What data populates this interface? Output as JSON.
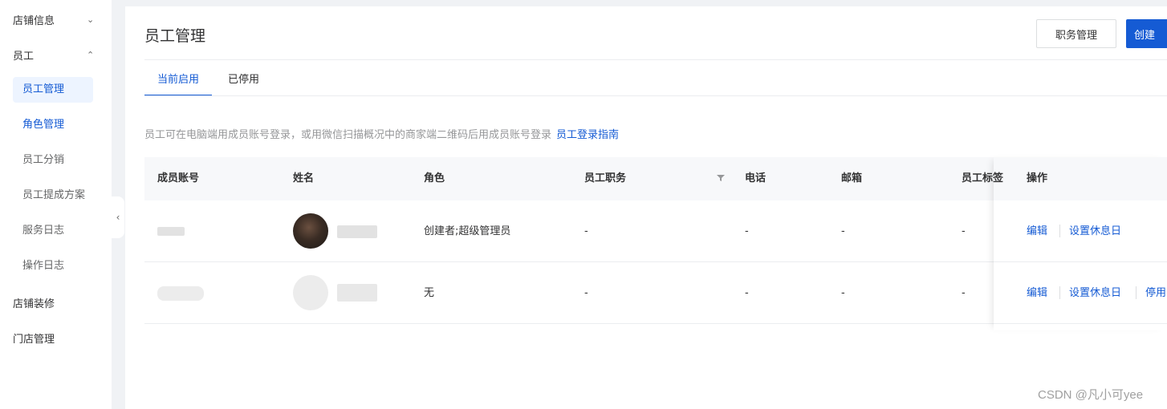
{
  "sidebar": {
    "groups": [
      {
        "label": "店铺信息",
        "arrow": "⌄"
      },
      {
        "label": "员工",
        "arrow": "⌃"
      },
      {
        "label": "店铺装修"
      },
      {
        "label": "门店管理"
      }
    ],
    "items": [
      {
        "label": "员工管理"
      },
      {
        "label": "角色管理"
      },
      {
        "label": "员工分销"
      },
      {
        "label": "员工提成方案"
      },
      {
        "label": "服务日志"
      },
      {
        "label": "操作日志"
      }
    ],
    "collapse_icon": "‹"
  },
  "header": {
    "title": "员工管理",
    "btn_roles": "职务管理",
    "btn_create": "创建"
  },
  "tabs": [
    {
      "label": "当前启用"
    },
    {
      "label": "已停用"
    }
  ],
  "tip": {
    "text": "员工可在电脑端用成员账号登录，或用微信扫描概况中的商家端二维码后用成员账号登录",
    "link": "员工登录指南"
  },
  "table": {
    "columns": [
      "成员账号",
      "姓名",
      "角色",
      "员工职务",
      "电话",
      "邮箱",
      "员工标签",
      "操作"
    ],
    "rows": [
      {
        "role": "创建者;超级管理员",
        "duty": "-",
        "phone": "-",
        "email": "-",
        "tag": "-",
        "actions": [
          "编辑",
          "设置休息日"
        ]
      },
      {
        "role": "无",
        "duty": "-",
        "phone": "-",
        "email": "-",
        "tag": "-",
        "actions": [
          "编辑",
          "设置休息日",
          "停用"
        ]
      }
    ]
  },
  "watermark": "CSDN @凡小可yee",
  "colors": {
    "primary": "#155bd4",
    "active_bg": "#edf4ff"
  }
}
